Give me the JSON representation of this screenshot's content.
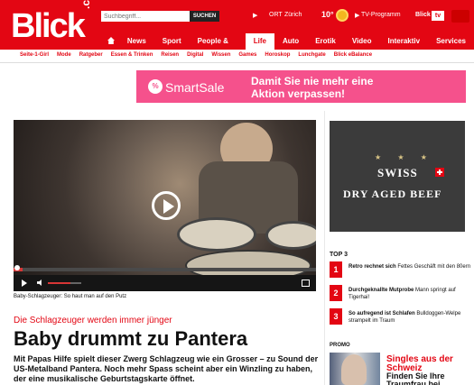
{
  "header": {
    "logo": "Blick",
    "logo_suffix": ".ch",
    "search": {
      "placeholder": "Suchbegriff...",
      "button": "SUCHEN"
    },
    "location": {
      "label": "ORT",
      "city": "Zürich",
      "temperature": "10°"
    },
    "tv_program": "TV-Programm",
    "blick_tv": {
      "label": "Blick",
      "badge": "tv"
    }
  },
  "main_nav": [
    "News",
    "Sport",
    "People & TV",
    "Life",
    "Auto",
    "Erotik",
    "Video",
    "Interaktiv",
    "Services"
  ],
  "sub_nav": [
    "Seite-1-Girl",
    "Mode",
    "Ratgeber",
    "Essen & Trinken",
    "Reisen",
    "Digital",
    "Wissen",
    "Games",
    "Horoskop",
    "Lunchgate",
    "Blick eBalance"
  ],
  "ad": {
    "badge": "%",
    "brand": "SmartSale",
    "line1": "Damit Sie nie mehr eine",
    "line2": "Aktion verpassen!"
  },
  "video": {
    "caption": "Baby-Schlagzeuger: So haut man auf den Putz",
    "progress": 0.03
  },
  "article": {
    "kicker": "Die Schlagzeuger werden immer jünger",
    "headline": "Baby drummt zu Pantera",
    "lead": "Mit Papas Hilfe spielt dieser Zwerg Schlagzeug wie ein Grosser – zu Sound der US-Metalband Pantera. Noch mehr Spass scheint aber ein Winzling zu haben, der eine musikalische Geburtstagskarte öffnet."
  },
  "right_ad": {
    "stars": "★ ★ ★",
    "line1": "SWISS",
    "line2": "DRY AGED BEEF"
  },
  "top3": {
    "title": "TOP 3",
    "items": [
      {
        "number": "1",
        "bold": "Retro rechnet sich",
        "text": " Fettes Geschäft mit den 80ern"
      },
      {
        "number": "2",
        "bold": "Durchgeknallte Mutprobe",
        "text": " Mann springt auf Tigerhai!"
      },
      {
        "number": "3",
        "bold": "So aufregend ist Schlafen",
        "text": " Bulldoggen-Welpe strampelt im Traum"
      }
    ]
  },
  "promo": {
    "title": "PROMO",
    "headline": "Singles aus der Schweiz",
    "subline": "Finden Sie Ihre Traumfrau bei"
  }
}
